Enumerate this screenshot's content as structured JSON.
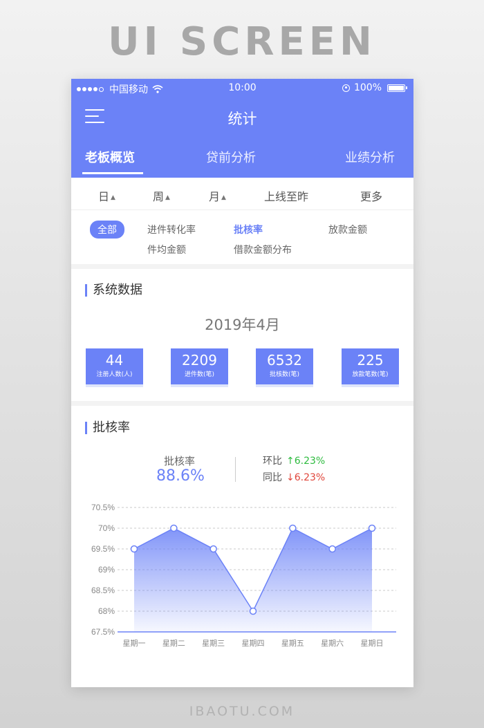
{
  "banner": {
    "title": "UI SCREEN",
    "footer": "IBAOTU.COM"
  },
  "status_bar": {
    "carrier": "中国移动",
    "time": "10:00",
    "battery": "100%"
  },
  "header": {
    "title": "统计"
  },
  "tabs": [
    {
      "label": "老板概览",
      "active": true
    },
    {
      "label": "贷前分析",
      "active": false
    },
    {
      "label": "业绩分析",
      "active": false
    }
  ],
  "periods": [
    {
      "label": "日"
    },
    {
      "label": "周"
    },
    {
      "label": "月"
    },
    {
      "label": "上线至昨"
    },
    {
      "label": "更多"
    }
  ],
  "period_arrow": "▲",
  "filters": [
    {
      "label": "全部"
    },
    {
      "label": "进件转化率"
    },
    {
      "label": "批核率"
    },
    {
      "label": "放款金额"
    },
    {
      "label": "件均金额"
    },
    {
      "label": "借款金额分布"
    }
  ],
  "system_data": {
    "title": "系统数据",
    "period_label": "2019年4月",
    "stats": [
      {
        "value": "44",
        "label": "注册人数(人)"
      },
      {
        "value": "2209",
        "label": "进件数(笔)"
      },
      {
        "value": "6532",
        "label": "批核数(笔)"
      },
      {
        "value": "225",
        "label": "放款笔数(笔)"
      }
    ]
  },
  "approval": {
    "title": "批核率",
    "rate_label": "批核率",
    "rate_value": "88.6%",
    "mom_label": "环比",
    "mom_value": "↑6.23%",
    "yoy_label": "同比",
    "yoy_value": "↓6.23%"
  },
  "colors": {
    "accent": "#6b82f7",
    "up": "#2dbb3e",
    "down": "#e0453a"
  },
  "chart_data": {
    "type": "area",
    "categories": [
      "星期一",
      "星期二",
      "星期三",
      "星期四",
      "星期五",
      "星期六",
      "星期日"
    ],
    "values": [
      69.5,
      70,
      69.5,
      68,
      70,
      69.5,
      70
    ],
    "y_ticks": [
      "67.5%",
      "68%",
      "68.5%",
      "69%",
      "69.5%",
      "70%",
      "70.5%"
    ],
    "ylim": [
      67.5,
      70.5
    ],
    "grid": true
  }
}
